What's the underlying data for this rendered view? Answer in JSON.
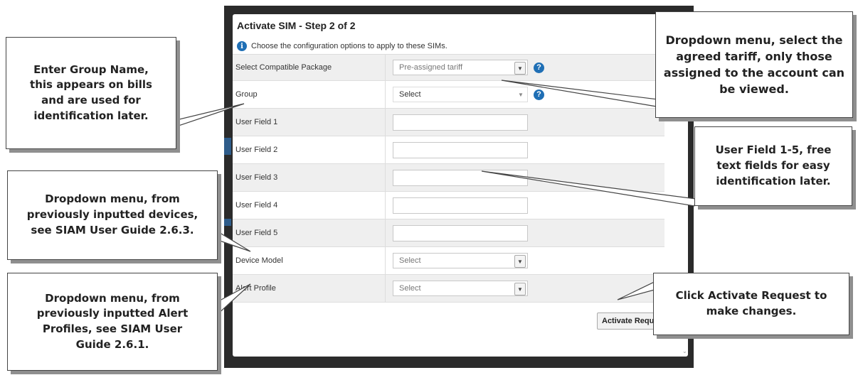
{
  "modal": {
    "title": "Activate SIM - Step 2 of 2",
    "info_text": "Choose the configuration options to apply to these SIMs.",
    "fields": [
      {
        "label": "Select Compatible Package",
        "type": "select",
        "value": "Pre-assigned tariff",
        "help": true
      },
      {
        "label": "Group",
        "type": "select",
        "value": "Select",
        "help": true
      },
      {
        "label": "User Field 1",
        "type": "text",
        "value": ""
      },
      {
        "label": "User Field 2",
        "type": "text",
        "value": ""
      },
      {
        "label": "User Field 3",
        "type": "text",
        "value": ""
      },
      {
        "label": "User Field 4",
        "type": "text",
        "value": ""
      },
      {
        "label": "User Field 5",
        "type": "text",
        "value": ""
      },
      {
        "label": "Device Model",
        "type": "select",
        "value": "Select"
      },
      {
        "label": "Alert Profile",
        "type": "select",
        "value": "Select"
      }
    ],
    "activate_button": "Activate Requ",
    "help_glyph": "?",
    "info_glyph": "i"
  },
  "callouts": {
    "group_name": "Enter Group Name, this appears on bills and are used for identification later.",
    "tariff": "Dropdown menu, select the agreed tariff, only those assigned to the account can be viewed.",
    "user_fields": "User Field 1-5, free text fields for easy identification later.",
    "device_model": "Dropdown menu, from previously inputted devices, see SIAM User Guide 2.6.3.",
    "alert_profile": "Dropdown menu, from previously inputted Alert Profiles, see SIAM User Guide 2.6.1.",
    "activate": "Click Activate Request to make changes."
  },
  "colors": {
    "accent": "#1f6fb5",
    "row_alt": "#efefef",
    "backdrop": "#2b2b2b"
  },
  "icons": [
    "info-icon",
    "help-icon",
    "chevron-down-icon"
  ]
}
